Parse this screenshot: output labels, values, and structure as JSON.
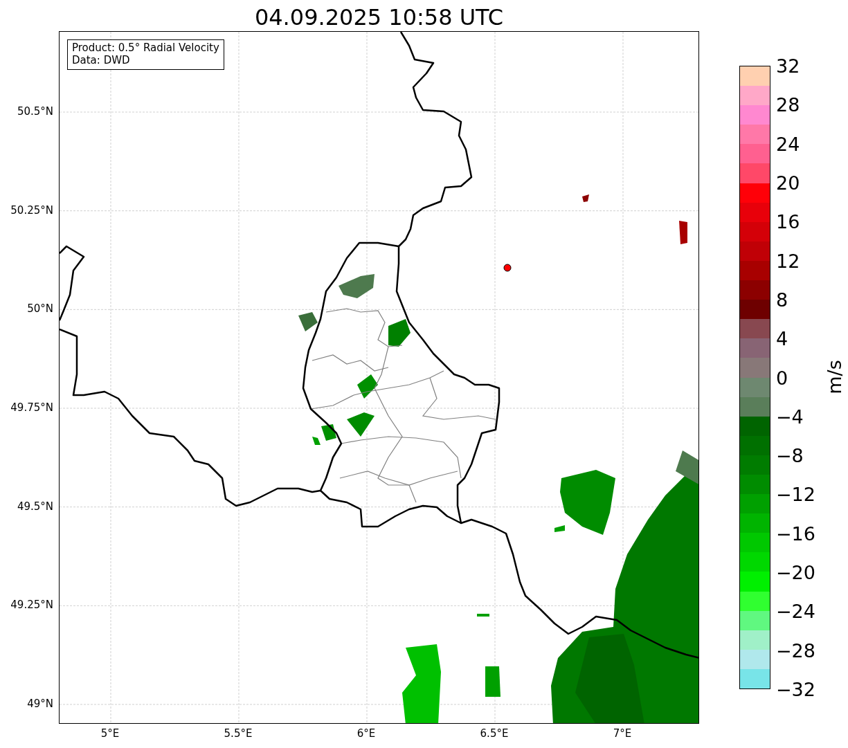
{
  "title": "04.09.2025 10:58 UTC",
  "info_box": [
    "Product: 0.5° Radial Velocity",
    "Data: DWD"
  ],
  "axes": {
    "yticks": [
      "50.5°N",
      "50.25°N",
      "50°N",
      "49.75°N",
      "49.5°N",
      "49.25°N",
      "49°N"
    ],
    "xticks": [
      "5°E",
      "5.5°E",
      "6°E",
      "6.5°E",
      "7°E"
    ]
  },
  "colorbar": {
    "label": "m/s",
    "ticks": [
      "32",
      "28",
      "24",
      "20",
      "16",
      "12",
      "8",
      "4",
      "0",
      "−4",
      "−8",
      "−12",
      "−16",
      "−20",
      "−24",
      "−28",
      "−32"
    ],
    "bands": [
      {
        "color": "#ffd0b0"
      },
      {
        "color": "#ffa8c8"
      },
      {
        "color": "#ff88d0"
      },
      {
        "color": "#ff78a8"
      },
      {
        "color": "#ff6090"
      },
      {
        "color": "#ff4868"
      },
      {
        "color": "#ff0008"
      },
      {
        "color": "#e8000a"
      },
      {
        "color": "#d40008"
      },
      {
        "color": "#c00006"
      },
      {
        "color": "#a80000"
      },
      {
        "color": "#8c0000"
      },
      {
        "color": "#6e0000"
      },
      {
        "color": "#884850"
      },
      {
        "color": "#886474"
      },
      {
        "color": "#887878"
      },
      {
        "color": "#6e8870"
      },
      {
        "color": "#5a7e5a"
      },
      {
        "color": "#006400"
      },
      {
        "color": "#007000"
      },
      {
        "color": "#007c00"
      },
      {
        "color": "#008c00"
      },
      {
        "color": "#00a000"
      },
      {
        "color": "#00b400"
      },
      {
        "color": "#00c800"
      },
      {
        "color": "#00d800"
      },
      {
        "color": "#00f000"
      },
      {
        "color": "#30ff30"
      },
      {
        "color": "#60f880"
      },
      {
        "color": "#a0f0c8"
      },
      {
        "color": "#b0e8ec"
      },
      {
        "color": "#78e4e8"
      }
    ]
  }
}
